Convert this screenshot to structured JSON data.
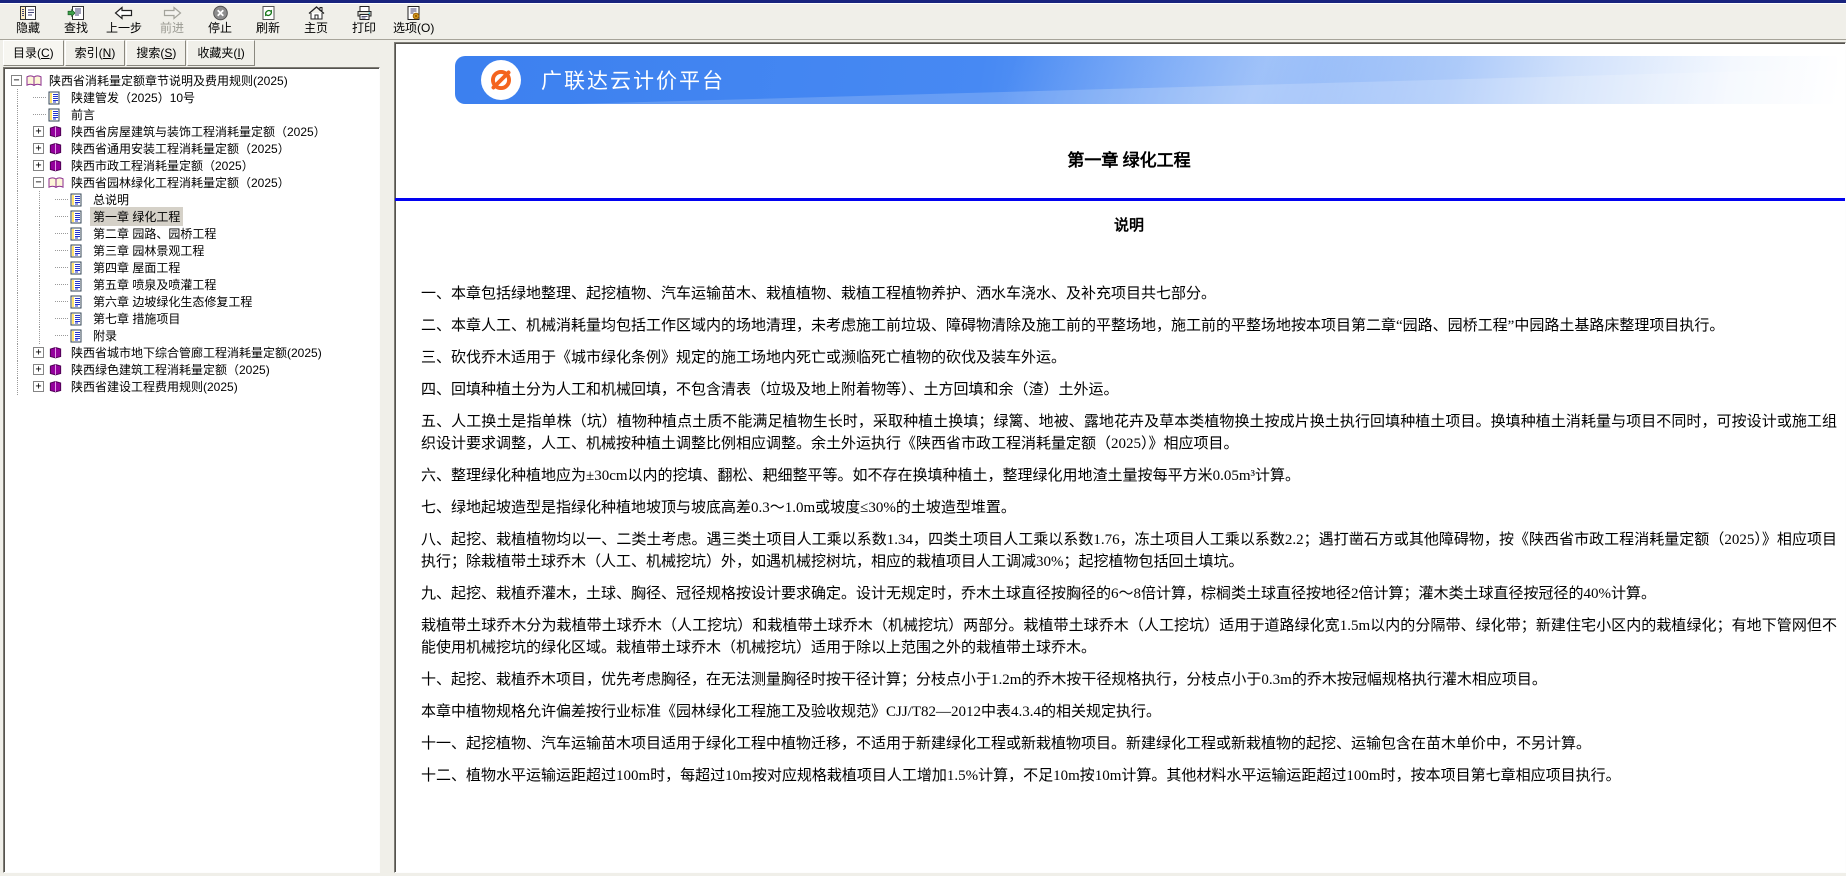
{
  "toolbar": {
    "buttons": [
      {
        "label": "隐藏"
      },
      {
        "label": "查找"
      },
      {
        "label": "上一步"
      },
      {
        "label": "前进"
      },
      {
        "label": "停止"
      },
      {
        "label": "刷新"
      },
      {
        "label": "主页"
      },
      {
        "label": "打印"
      },
      {
        "label": "选项(O)"
      }
    ]
  },
  "nav_tabs": [
    {
      "pre": "目录(",
      "key": "C",
      "post": ")"
    },
    {
      "pre": "索引(",
      "key": "N",
      "post": ")"
    },
    {
      "pre": "搜索(",
      "key": "S",
      "post": ")"
    },
    {
      "pre": "收藏夹(",
      "key": "I",
      "post": ")"
    }
  ],
  "tree": {
    "items": [
      {
        "label": "陕西省消耗量定额章节说明及费用规则(2025)",
        "toggle": "−"
      },
      {
        "label": "陕建管发（2025）10号",
        "toggle": ""
      },
      {
        "label": "前言",
        "toggle": ""
      },
      {
        "label": "陕西省房屋建筑与装饰工程消耗量定额（2025）",
        "toggle": "+"
      },
      {
        "label": "陕西省通用安装工程消耗量定额（2025）",
        "toggle": "+"
      },
      {
        "label": "陕西市政工程消耗量定额（2025）",
        "toggle": "+"
      },
      {
        "label": "陕西省园林绿化工程消耗量定额（2025）",
        "toggle": "−"
      },
      {
        "label": "总说明",
        "toggle": ""
      },
      {
        "label": "第一章 绿化工程",
        "toggle": ""
      },
      {
        "label": "第二章 园路、园桥工程",
        "toggle": ""
      },
      {
        "label": "第三章 园林景观工程",
        "toggle": ""
      },
      {
        "label": "第四章 屋面工程",
        "toggle": ""
      },
      {
        "label": "第五章 喷泉及喷灌工程",
        "toggle": ""
      },
      {
        "label": "第六章 边坡绿化生态修复工程",
        "toggle": ""
      },
      {
        "label": "第七章 措施项目",
        "toggle": ""
      },
      {
        "label": "附录",
        "toggle": ""
      },
      {
        "label": "陕西省城市地下综合管廊工程消耗量定额(2025)",
        "toggle": "+"
      },
      {
        "label": "陕西绿色建筑工程消耗量定额（2025)",
        "toggle": "+"
      },
      {
        "label": "陕西省建设工程费用规则(2025)",
        "toggle": "+"
      }
    ]
  },
  "content": {
    "banner_title": "广联达云计价平台",
    "chapter_title": "第一章 绿化工程",
    "section_title": "说明",
    "colors": {
      "banner_blue": "#3c80ef",
      "rule_blue": "#0202f0",
      "logo_orange": "#f4641e"
    },
    "paragraphs": [
      "一、本章包括绿地整理、起挖植物、汽车运输苗木、栽植植物、栽植工程植物养护、洒水车浇水、及补充项目共七部分。",
      "二、本章人工、机械消耗量均包括工作区域内的场地清理，未考虑施工前垃圾、障碍物清除及施工前的平整场地，施工前的平整场地按本项目第二章“园路、园桥工程”中园路土基路床整理项目执行。",
      "三、砍伐乔木适用于《城市绿化条例》规定的施工场地内死亡或濒临死亡植物的砍伐及装车外运。",
      "四、回填种植土分为人工和机械回填，不包含清表（垃圾及地上附着物等）、土方回填和余（渣）土外运。",
      "五、人工换土是指单株（坑）植物种植点土质不能满足植物生长时，采取种植土换填；绿篱、地被、露地花卉及草本类植物换土按成片换土执行回填种植土项目。换填种植土消耗量与项目不同时，可按设计或施工组织设计要求调整，人工、机械按种植土调整比例相应调整。余土外运执行《陕西省市政工程消耗量定额（2025）》相应项目。",
      "六、整理绿化种植地应为±30cm以内的挖填、翻松、耙细整平等。如不存在换填种植土，整理绿化用地渣土量按每平方米0.05m³计算。",
      "七、绿地起坡造型是指绿化种植地坡顶与坡底高差0.3～1.0m或坡度≤30%的土坡造型堆置。",
      "八、起挖、栽植植物均以一、二类土考虑。遇三类土项目人工乘以系数1.34，四类土项目人工乘以系数1.76，冻土项目人工乘以系数2.2；遇打凿石方或其他障碍物，按《陕西省市政工程消耗量定额（2025）》相应项目执行；除栽植带土球乔木（人工、机械挖坑）外，如遇机械挖树坑，相应的栽植项目人工调减30%；起挖植物包括回土填坑。",
      "九、起挖、栽植乔灌木，土球、胸径、冠径规格按设计要求确定。设计无规定时，乔木土球直径按胸径的6～8倍计算，棕榈类土球直径按地径2倍计算；灌木类土球直径按冠径的40%计算。",
      "栽植带土球乔木分为栽植带土球乔木（人工挖坑）和栽植带土球乔木（机械挖坑）两部分。栽植带土球乔木（人工挖坑）适用于道路绿化宽1.5m以内的分隔带、绿化带；新建住宅小区内的栽植绿化；有地下管网但不能使用机械挖坑的绿化区域。栽植带土球乔木（机械挖坑）适用于除以上范围之外的栽植带土球乔木。",
      "十、起挖、栽植乔木项目，优先考虑胸径，在无法测量胸径时按干径计算；分枝点小于1.2m的乔木按干径规格执行，分枝点小于0.3m的乔木按冠幅规格执行灌木相应项目。",
      "本章中植物规格允许偏差按行业标准《园林绿化工程施工及验收规范》CJJ/T82—2012中表4.3.4的相关规定执行。",
      "十一、起挖植物、汽车运输苗木项目适用于绿化工程中植物迁移，不适用于新建绿化工程或新栽植物项目。新建绿化工程或新栽植物的起挖、运输包含在苗木单价中，不另计算。",
      "十二、植物水平运输运距超过100m时，每超过10m按对应规格栽植项目人工增加1.5%计算，不足10m按10m计算。其他材料水平运输运距超过100m时，按本项目第七章相应项目执行。"
    ]
  }
}
